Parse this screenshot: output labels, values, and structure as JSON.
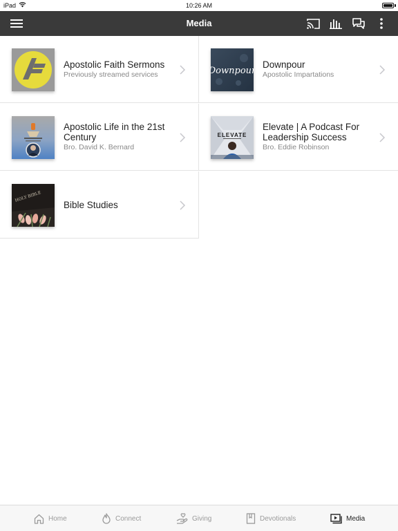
{
  "status_bar": {
    "device": "iPad",
    "time": "10:26 AM",
    "battery_level": 1.0
  },
  "nav_bar": {
    "title": "Media",
    "icons": [
      "menu-icon",
      "cast-icon",
      "audio-bars-icon",
      "chat-icon",
      "more-vertical-icon"
    ]
  },
  "items": [
    {
      "title": "Apostolic Faith Sermons",
      "subtitle": "Previously streamed services",
      "thumb": "af-logo-icon",
      "thumb_color": "#e6db3c"
    },
    {
      "title": "Downpour",
      "subtitle": "Apostolic Impartations",
      "thumb": "downpour-cover",
      "thumb_color": "#2f3d4e",
      "thumb_text": "Downpour"
    },
    {
      "title": "Apostolic Life in the 21st Century",
      "subtitle": "Bro. David K. Bernard",
      "thumb": "apostolic-life-cover",
      "thumb_color": "#5a86b8"
    },
    {
      "title": "Elevate | A Podcast For Leadership Success",
      "subtitle": "Bro. Eddie Robinson",
      "thumb": "elevate-cover",
      "thumb_color": "#dfe3e8",
      "thumb_text": "ELEVATE"
    },
    {
      "title": "Bible Studies",
      "subtitle": "",
      "thumb": "bible-cover",
      "thumb_color": "#2a2522",
      "thumb_text": "HOLY BIBLE"
    }
  ],
  "tab_bar": {
    "tabs": [
      {
        "label": "Home",
        "icon": "home-icon",
        "active": false
      },
      {
        "label": "Connect",
        "icon": "flame-icon",
        "active": false
      },
      {
        "label": "Giving",
        "icon": "giving-hand-icon",
        "active": false
      },
      {
        "label": "Devotionals",
        "icon": "bookmark-book-icon",
        "active": false
      },
      {
        "label": "Media",
        "icon": "media-play-icon",
        "active": true
      }
    ]
  },
  "colors": {
    "nav_bg": "#3a3a3a",
    "tab_bg": "#f7f7f7",
    "active_tab": "#222222",
    "inactive_tab": "#9a9a9a",
    "subtitle": "#888888"
  }
}
